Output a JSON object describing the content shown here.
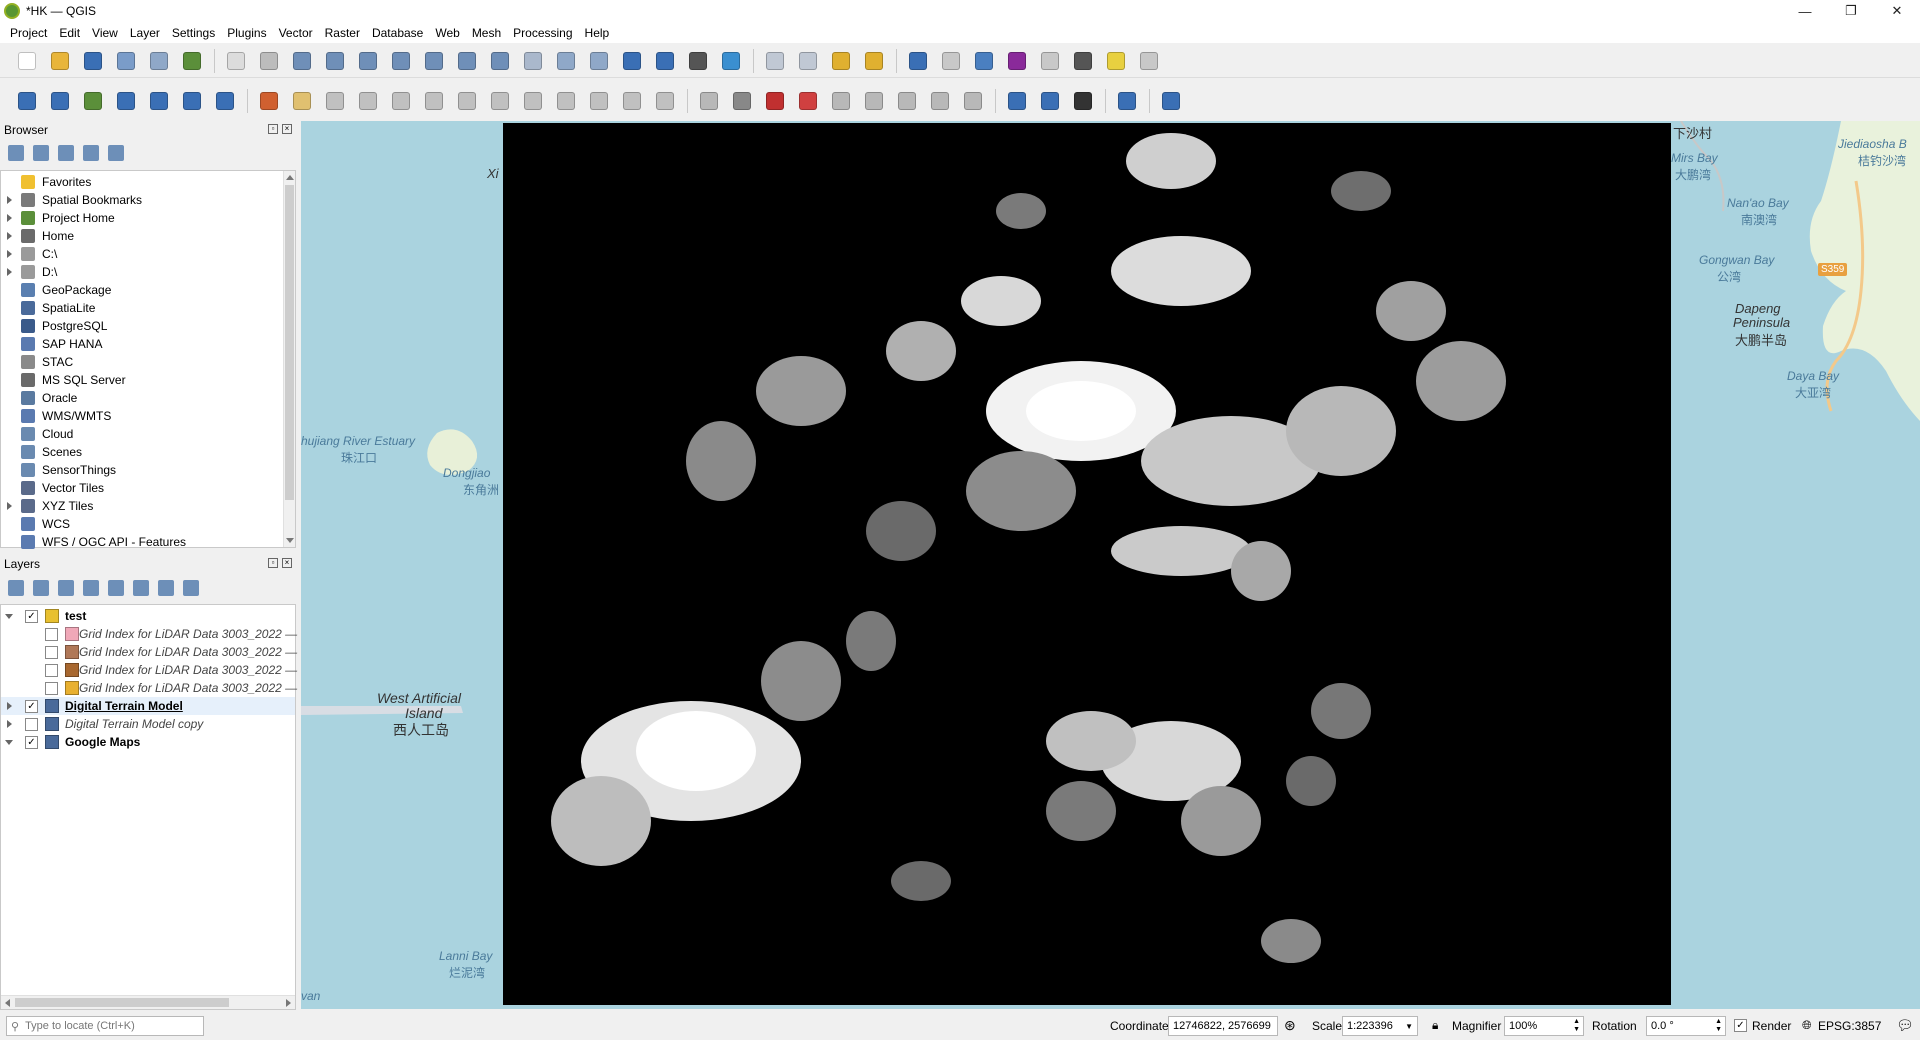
{
  "window": {
    "title": "*HK — QGIS",
    "controls": [
      "—",
      "❐",
      "✕"
    ]
  },
  "menu": [
    "Project",
    "Edit",
    "View",
    "Layer",
    "Settings",
    "Plugins",
    "Vector",
    "Raster",
    "Database",
    "Web",
    "Mesh",
    "Processing",
    "Help"
  ],
  "toolbar1": [
    {
      "name": "new-project-icon",
      "color": "#ffffff"
    },
    {
      "name": "open-project-icon",
      "color": "#e8b53a"
    },
    {
      "name": "save-project-icon",
      "color": "#3a6fb5"
    },
    {
      "name": "new-print-layout-icon",
      "color": "#7a9cc9"
    },
    {
      "name": "layout-manager-icon",
      "color": "#8fa8c8"
    },
    {
      "name": "style-manager-icon",
      "color": "#5b8f3a"
    },
    {
      "sep": true
    },
    {
      "name": "pan-map-icon",
      "color": "#dcdcdc"
    },
    {
      "name": "pan-to-selection-icon",
      "color": "#bcbcbc"
    },
    {
      "name": "zoom-in-icon",
      "color": "#6f8fb8"
    },
    {
      "name": "zoom-out-icon",
      "color": "#6f8fb8"
    },
    {
      "name": "zoom-full-icon",
      "color": "#6f8fb8"
    },
    {
      "name": "zoom-to-selection-icon",
      "color": "#6f8fb8"
    },
    {
      "name": "zoom-to-layer-icon",
      "color": "#6f8fb8"
    },
    {
      "name": "zoom-native-icon",
      "color": "#6f8fb8"
    },
    {
      "name": "zoom-last-icon",
      "color": "#6f8fb8"
    },
    {
      "name": "zoom-next-icon",
      "color": "#aab8cc"
    },
    {
      "name": "new-map-view-icon",
      "color": "#8fa8c8"
    },
    {
      "name": "new-3d-map-icon",
      "color": "#8fa8c8"
    },
    {
      "name": "new-bookmark-icon",
      "color": "#3a6fb5"
    },
    {
      "name": "show-bookmarks-icon",
      "color": "#3a6fb5"
    },
    {
      "name": "temporal-controller-icon",
      "color": "#555555"
    },
    {
      "name": "refresh-icon",
      "color": "#3a8fd0"
    },
    {
      "sep": true
    },
    {
      "name": "select-features-icon",
      "color": "#c0c8d4"
    },
    {
      "name": "select-by-value-icon",
      "color": "#c0c8d4"
    },
    {
      "name": "deselect-icon",
      "color": "#e0b030"
    },
    {
      "name": "select-by-location-icon",
      "color": "#e0b030"
    },
    {
      "sep": true
    },
    {
      "name": "identify-icon",
      "color": "#3a6fb5"
    },
    {
      "name": "attribute-table-icon",
      "color": "#c8c8c8"
    },
    {
      "name": "processing-toolbox-icon",
      "color": "#4a7fc0"
    },
    {
      "name": "statistics-icon",
      "color": "#8a2a9a"
    },
    {
      "name": "field-calculator-icon",
      "color": "#c8c8c8"
    },
    {
      "name": "measure-icon",
      "color": "#555555"
    },
    {
      "name": "map-tips-icon",
      "color": "#e8d040"
    },
    {
      "name": "locator-settings-icon",
      "color": "#c8c8c8"
    }
  ],
  "toolbar2": [
    {
      "name": "data-source-manager-icon",
      "color": "#3a6fb5"
    },
    {
      "name": "new-geopackage-layer-icon",
      "color": "#3a6fb5"
    },
    {
      "name": "new-shapefile-layer-icon",
      "color": "#5b8f3a"
    },
    {
      "name": "new-spatialite-layer-icon",
      "color": "#3a6fb5"
    },
    {
      "name": "new-temporary-layer-icon",
      "color": "#3a6fb5"
    },
    {
      "name": "new-virtual-layer-icon",
      "color": "#3a6fb5"
    },
    {
      "name": "add-raster-layer-icon",
      "color": "#3a6fb5"
    },
    {
      "sep": true
    },
    {
      "name": "current-edits-icon",
      "color": "#d06030"
    },
    {
      "name": "toggle-editing-icon",
      "color": "#e0c070"
    },
    {
      "name": "save-edits-icon",
      "color": "#c0c0c0"
    },
    {
      "name": "digitize-icon",
      "color": "#c0c0c0"
    },
    {
      "name": "add-polygon-icon",
      "color": "#c0c0c0"
    },
    {
      "name": "vertex-tool-icon",
      "color": "#c0c0c0"
    },
    {
      "name": "modify-attributes-icon",
      "color": "#c0c0c0"
    },
    {
      "name": "delete-selected-icon",
      "color": "#c0c0c0"
    },
    {
      "name": "cut-features-icon",
      "color": "#c0c0c0"
    },
    {
      "name": "copy-features-icon",
      "color": "#c0c0c0"
    },
    {
      "name": "paste-features-icon",
      "color": "#c0c0c0"
    },
    {
      "name": "undo-icon",
      "color": "#c0c0c0"
    },
    {
      "name": "redo-icon",
      "color": "#c0c0c0"
    },
    {
      "sep": true
    },
    {
      "name": "label-toolbar-icon",
      "color": "#b8b8b8"
    },
    {
      "name": "diagram-icon",
      "color": "#888888"
    },
    {
      "name": "layer-labeling-icon",
      "color": "#c03030"
    },
    {
      "name": "label-pin-icon",
      "color": "#d04040"
    },
    {
      "name": "show-hide-labels-icon",
      "color": "#b8b8b8"
    },
    {
      "name": "move-label-icon",
      "color": "#b8b8b8"
    },
    {
      "name": "rotate-label-icon",
      "color": "#b8b8b8"
    },
    {
      "name": "change-label-icon",
      "color": "#b8b8b8"
    },
    {
      "name": "highlight-label-icon",
      "color": "#b8b8b8"
    },
    {
      "sep": true
    },
    {
      "name": "metasearch-icon",
      "color": "#3a6fb5"
    },
    {
      "name": "quickmapservices-icon",
      "color": "#3a6fb5"
    },
    {
      "name": "globe-plugin-icon",
      "color": "#333333"
    },
    {
      "sep": true
    },
    {
      "name": "python-console-icon",
      "color": "#3a6fb5"
    },
    {
      "sep": true
    },
    {
      "name": "help-icon",
      "color": "#3a6fb5"
    }
  ],
  "browser": {
    "title": "Browser",
    "tools": [
      "add-selected-icon",
      "refresh-icon",
      "filter-icon",
      "collapse-all-icon",
      "properties-icon"
    ],
    "items": [
      {
        "label": "Favorites",
        "icon": "star-icon",
        "color": "#f0c030",
        "arrow": false
      },
      {
        "label": "Spatial Bookmarks",
        "icon": "bookmark-icon",
        "color": "#7a7a7a",
        "arrow": true
      },
      {
        "label": "Project Home",
        "icon": "project-home-icon",
        "color": "#5b8f3a",
        "arrow": true
      },
      {
        "label": "Home",
        "icon": "home-icon",
        "color": "#6a6a6a",
        "arrow": true
      },
      {
        "label": "C:\\",
        "icon": "drive-icon",
        "color": "#9a9a9a",
        "arrow": true
      },
      {
        "label": "D:\\",
        "icon": "drive-icon",
        "color": "#9a9a9a",
        "arrow": true
      },
      {
        "label": "GeoPackage",
        "icon": "geopackage-icon",
        "color": "#5a7fb0",
        "arrow": false
      },
      {
        "label": "SpatiaLite",
        "icon": "spatialite-icon",
        "color": "#4a6a9a",
        "arrow": false
      },
      {
        "label": "PostgreSQL",
        "icon": "postgresql-icon",
        "color": "#3a5a8a",
        "arrow": false
      },
      {
        "label": "SAP HANA",
        "icon": "sap-hana-icon",
        "color": "#5a7ab0",
        "arrow": false
      },
      {
        "label": "STAC",
        "icon": "stac-icon",
        "color": "#8a8a8a",
        "arrow": false
      },
      {
        "label": "MS SQL Server",
        "icon": "mssql-icon",
        "color": "#6a6a6a",
        "arrow": false
      },
      {
        "label": "Oracle",
        "icon": "oracle-icon",
        "color": "#5a7aa0",
        "arrow": false
      },
      {
        "label": "WMS/WMTS",
        "icon": "wms-icon",
        "color": "#5a7ab0",
        "arrow": false
      },
      {
        "label": "Cloud",
        "icon": "cloud-icon",
        "color": "#6a8ab0",
        "arrow": false
      },
      {
        "label": "Scenes",
        "icon": "scenes-icon",
        "color": "#6a8ab0",
        "arrow": false
      },
      {
        "label": "SensorThings",
        "icon": "sensorthings-icon",
        "color": "#6a8ab0",
        "arrow": false
      },
      {
        "label": "Vector Tiles",
        "icon": "vector-tiles-icon",
        "color": "#5a6a8a",
        "arrow": false
      },
      {
        "label": "XYZ Tiles",
        "icon": "xyz-tiles-icon",
        "color": "#5a6a8a",
        "arrow": true
      },
      {
        "label": "WCS",
        "icon": "wcs-icon",
        "color": "#5a7ab0",
        "arrow": false
      },
      {
        "label": "WFS / OGC API - Features",
        "icon": "wfs-icon",
        "color": "#5a7ab0",
        "arrow": false
      }
    ]
  },
  "layers": {
    "title": "Layers",
    "tools": [
      "open-styling-icon",
      "add-group-icon",
      "manage-visibility-icon",
      "filter-legend-icon",
      "filter-expression-icon",
      "expand-all-icon",
      "collapse-all-icon",
      "remove-layer-icon"
    ],
    "items": [
      {
        "label": "test",
        "icon": "group-icon",
        "color": "#e8c030",
        "checked": true,
        "indent": 0,
        "bold": true,
        "italic": false,
        "underline": false,
        "arrow": "open"
      },
      {
        "label": "Grid Index for LiDAR Data 3003_2022 —",
        "icon": "polygon-layer-icon",
        "color": "#f0a8b8",
        "checked": false,
        "indent": 1,
        "bold": false,
        "italic": true,
        "underline": false,
        "arrow": "none"
      },
      {
        "label": "Grid Index for LiDAR Data 3003_2022 —",
        "icon": "polygon-layer-icon",
        "color": "#b07858",
        "checked": false,
        "indent": 1,
        "bold": false,
        "italic": true,
        "underline": false,
        "arrow": "none"
      },
      {
        "label": "Grid Index for LiDAR Data 3003_2022 —",
        "icon": "polygon-layer-icon",
        "color": "#a86830",
        "checked": false,
        "indent": 1,
        "bold": false,
        "italic": true,
        "underline": false,
        "arrow": "none"
      },
      {
        "label": "Grid Index for LiDAR Data 3003_2022 —",
        "icon": "polygon-layer-icon",
        "color": "#e8b030",
        "checked": false,
        "indent": 1,
        "bold": false,
        "italic": true,
        "underline": false,
        "arrow": "none"
      },
      {
        "label": "Digital Terrain Model",
        "icon": "raster-layer-icon",
        "color": "#4a6a9a",
        "checked": true,
        "indent": 0,
        "bold": true,
        "italic": false,
        "underline": true,
        "arrow": "closed",
        "selected": true
      },
      {
        "label": "Digital Terrain Model copy",
        "icon": "raster-layer-icon",
        "color": "#4a6a9a",
        "checked": false,
        "indent": 0,
        "bold": false,
        "italic": true,
        "underline": false,
        "arrow": "closed"
      },
      {
        "label": "Google Maps",
        "icon": "raster-layer-icon",
        "color": "#4a6a9a",
        "checked": true,
        "indent": 0,
        "bold": true,
        "italic": false,
        "underline": false,
        "arrow": "open"
      }
    ]
  },
  "map": {
    "labels": {
      "zhujiang_en": "hujiang River Estuary",
      "zhujiang_zh": "珠江口",
      "dongjiao_en": "Dongjiao",
      "dongjiao_zh": "东角洲",
      "west_island_en1": "West Artificial",
      "west_island_en2": "Island",
      "west_island_zh": "西人工岛",
      "lanni_en": "Lanni Bay",
      "lanni_zh": "烂泥湾",
      "van": "van",
      "xi": "Xi",
      "shasha": "下沙村",
      "mirs_en": "Mirs Bay",
      "mirs_zh": "大鹏湾",
      "jiediaosha_en": "Jiediaosha B",
      "jiediaosha_zh": "桔钓沙湾",
      "nanao_en": "Nan'ao Bay",
      "nanao_zh": "南澳湾",
      "gongwan_en": "Gongwan Bay",
      "gongwan_zh": "公湾",
      "road": "S359",
      "dapeng_en1": "Dapeng",
      "dapeng_en2": "Peninsula",
      "dapeng_zh": "大鹏半岛",
      "daya_en": "Daya Bay",
      "daya_zh": "大亚湾"
    }
  },
  "status": {
    "locator_placeholder": "Type to locate (Ctrl+K)",
    "coordinate_label": "Coordinate",
    "coordinate_value": "12746822, 2576699",
    "scale_label": "Scale",
    "scale_value": "1:223396",
    "magnifier_label": "Magnifier",
    "magnifier_value": "100%",
    "rotation_label": "Rotation",
    "rotation_value": "0.0 °",
    "render_label": "Render",
    "render_checked": true,
    "crs": "EPSG:3857"
  }
}
